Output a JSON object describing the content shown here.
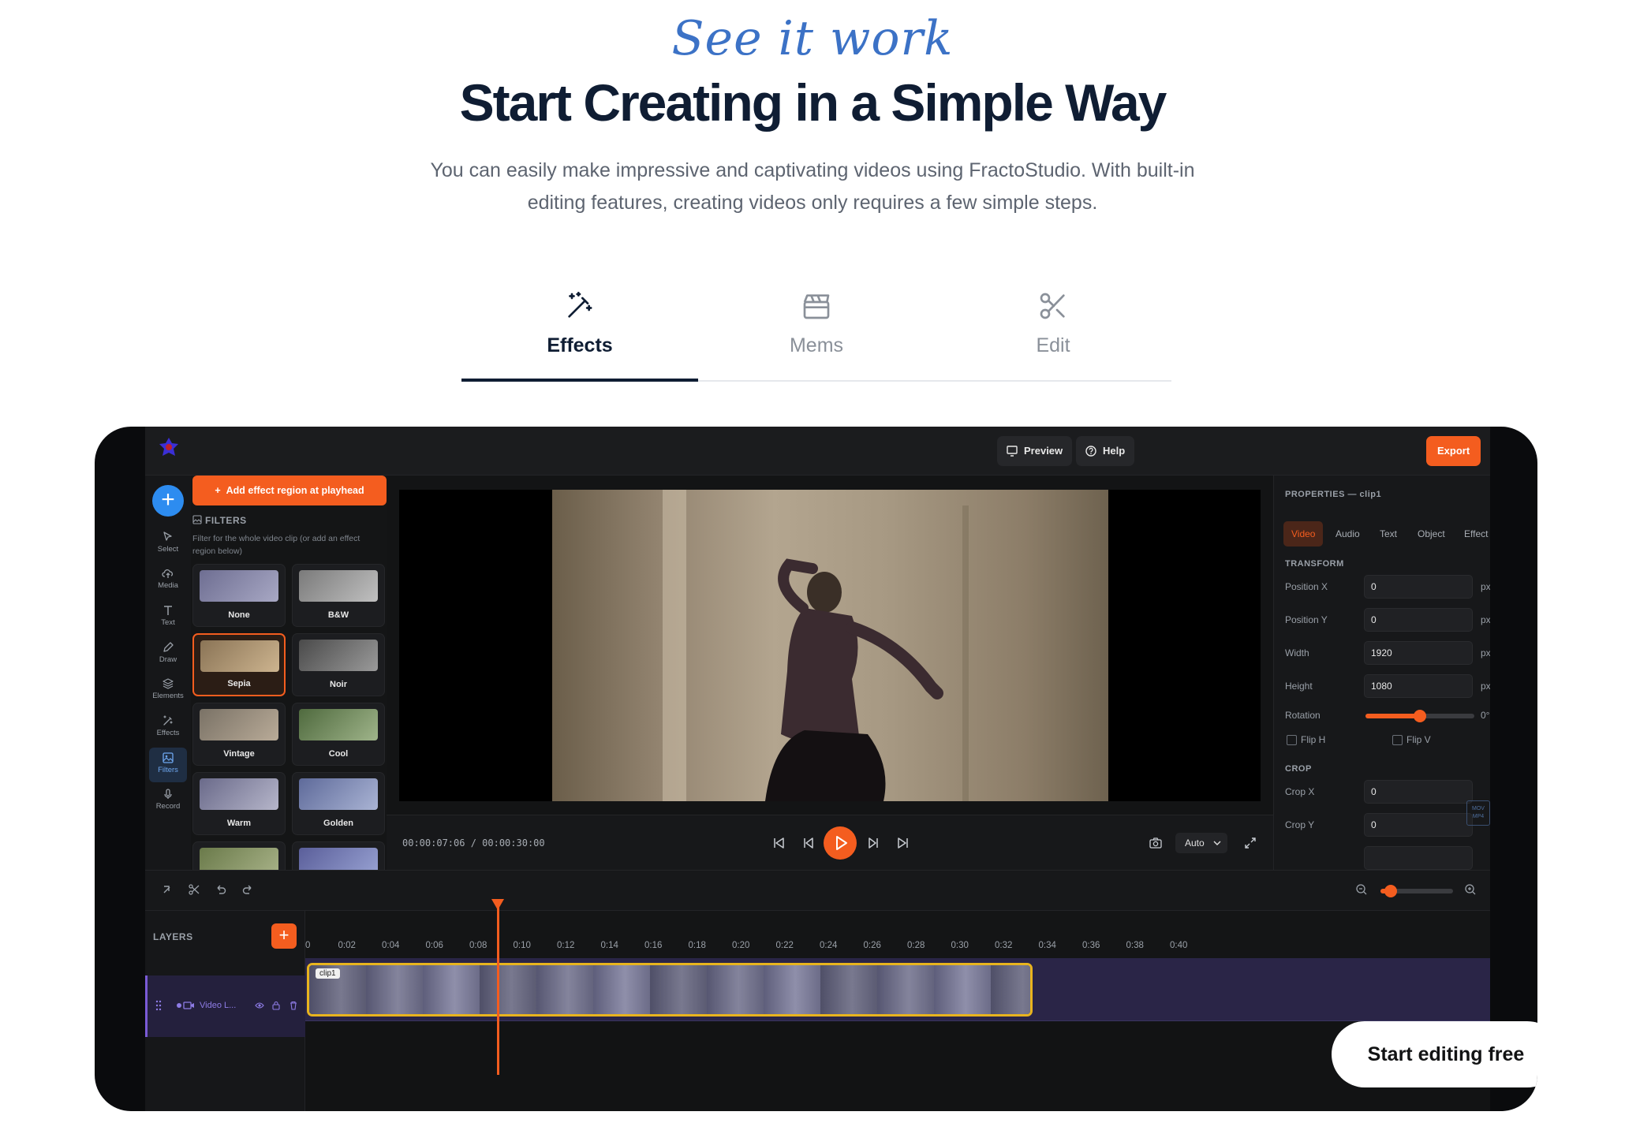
{
  "hero": {
    "eyebrow": "See it work",
    "title": "Start Creating in a Simple Way",
    "subtitle": "You can easily make impressive and captivating videos using FractoStudio. With built-in editing features, creating videos only requires a few simple steps."
  },
  "tabs": [
    {
      "label": "Effects",
      "icon": "magic-wand-icon",
      "active": true
    },
    {
      "label": "Mems",
      "icon": "clapperboard-icon",
      "active": false
    },
    {
      "label": "Edit",
      "icon": "scissors-icon",
      "active": false
    }
  ],
  "editor": {
    "topbar": {
      "preview": "Preview",
      "help": "Help",
      "export": "Export"
    },
    "rail": [
      {
        "label": "Select",
        "icon": "cursor-icon"
      },
      {
        "label": "Media",
        "icon": "upload-cloud-icon"
      },
      {
        "label": "Text",
        "icon": "text-icon"
      },
      {
        "label": "Draw",
        "icon": "pencil-icon"
      },
      {
        "label": "Elements",
        "icon": "layers-icon"
      },
      {
        "label": "Effects",
        "icon": "magic-wand-icon"
      },
      {
        "label": "Filters",
        "icon": "image-icon",
        "active": true
      },
      {
        "label": "Record",
        "icon": "microphone-icon"
      }
    ],
    "filters": {
      "add_button": "Add effect region at playhead",
      "heading": "FILTERS",
      "description": "Filter for the whole video clip (or add an effect region below)",
      "items": [
        "None",
        "B&W",
        "Sepia",
        "Noir",
        "Vintage",
        "Cool",
        "Warm",
        "Golden"
      ],
      "selected": "Sepia"
    },
    "player": {
      "timecode": "00:00:07:06 / 00:00:30:00",
      "quality": "Auto"
    },
    "properties": {
      "title": "PROPERTIES — clip1",
      "tabs": [
        "Video",
        "Audio",
        "Text",
        "Object",
        "Effect"
      ],
      "active_tab": "Video",
      "transform_heading": "TRANSFORM",
      "position_x_label": "Position X",
      "position_x": "0",
      "position_y_label": "Position Y",
      "position_y": "0",
      "width_label": "Width",
      "width": "1920",
      "height_label": "Height",
      "height": "1080",
      "unit": "px",
      "rotation_label": "Rotation",
      "rotation": "0°",
      "flip_h": "Flip H",
      "flip_v": "Flip V",
      "crop_heading": "CROP",
      "crop_x_label": "Crop X",
      "crop_x": "0",
      "crop_y_label": "Crop Y",
      "crop_y": "0"
    },
    "timeline": {
      "layers_heading": "LAYERS",
      "layer_name": "Video L...",
      "clip_label": "clip1",
      "ticks": [
        "0",
        "0:02",
        "0:04",
        "0:06",
        "0:08",
        "0:10",
        "0:12",
        "0:14",
        "0:16",
        "0:18",
        "0:20",
        "0:22",
        "0:24",
        "0:26",
        "0:28",
        "0:30",
        "0:32",
        "0:34",
        "0:36",
        "0:38",
        "0:40"
      ],
      "playhead_seconds": 7.2
    },
    "watermark": "MOV MP4"
  },
  "cta": "Start editing free",
  "colors": {
    "accent": "#f45d1f",
    "heading": "#0f1d33",
    "script": "#3c72c6",
    "track": "#2a2547"
  }
}
